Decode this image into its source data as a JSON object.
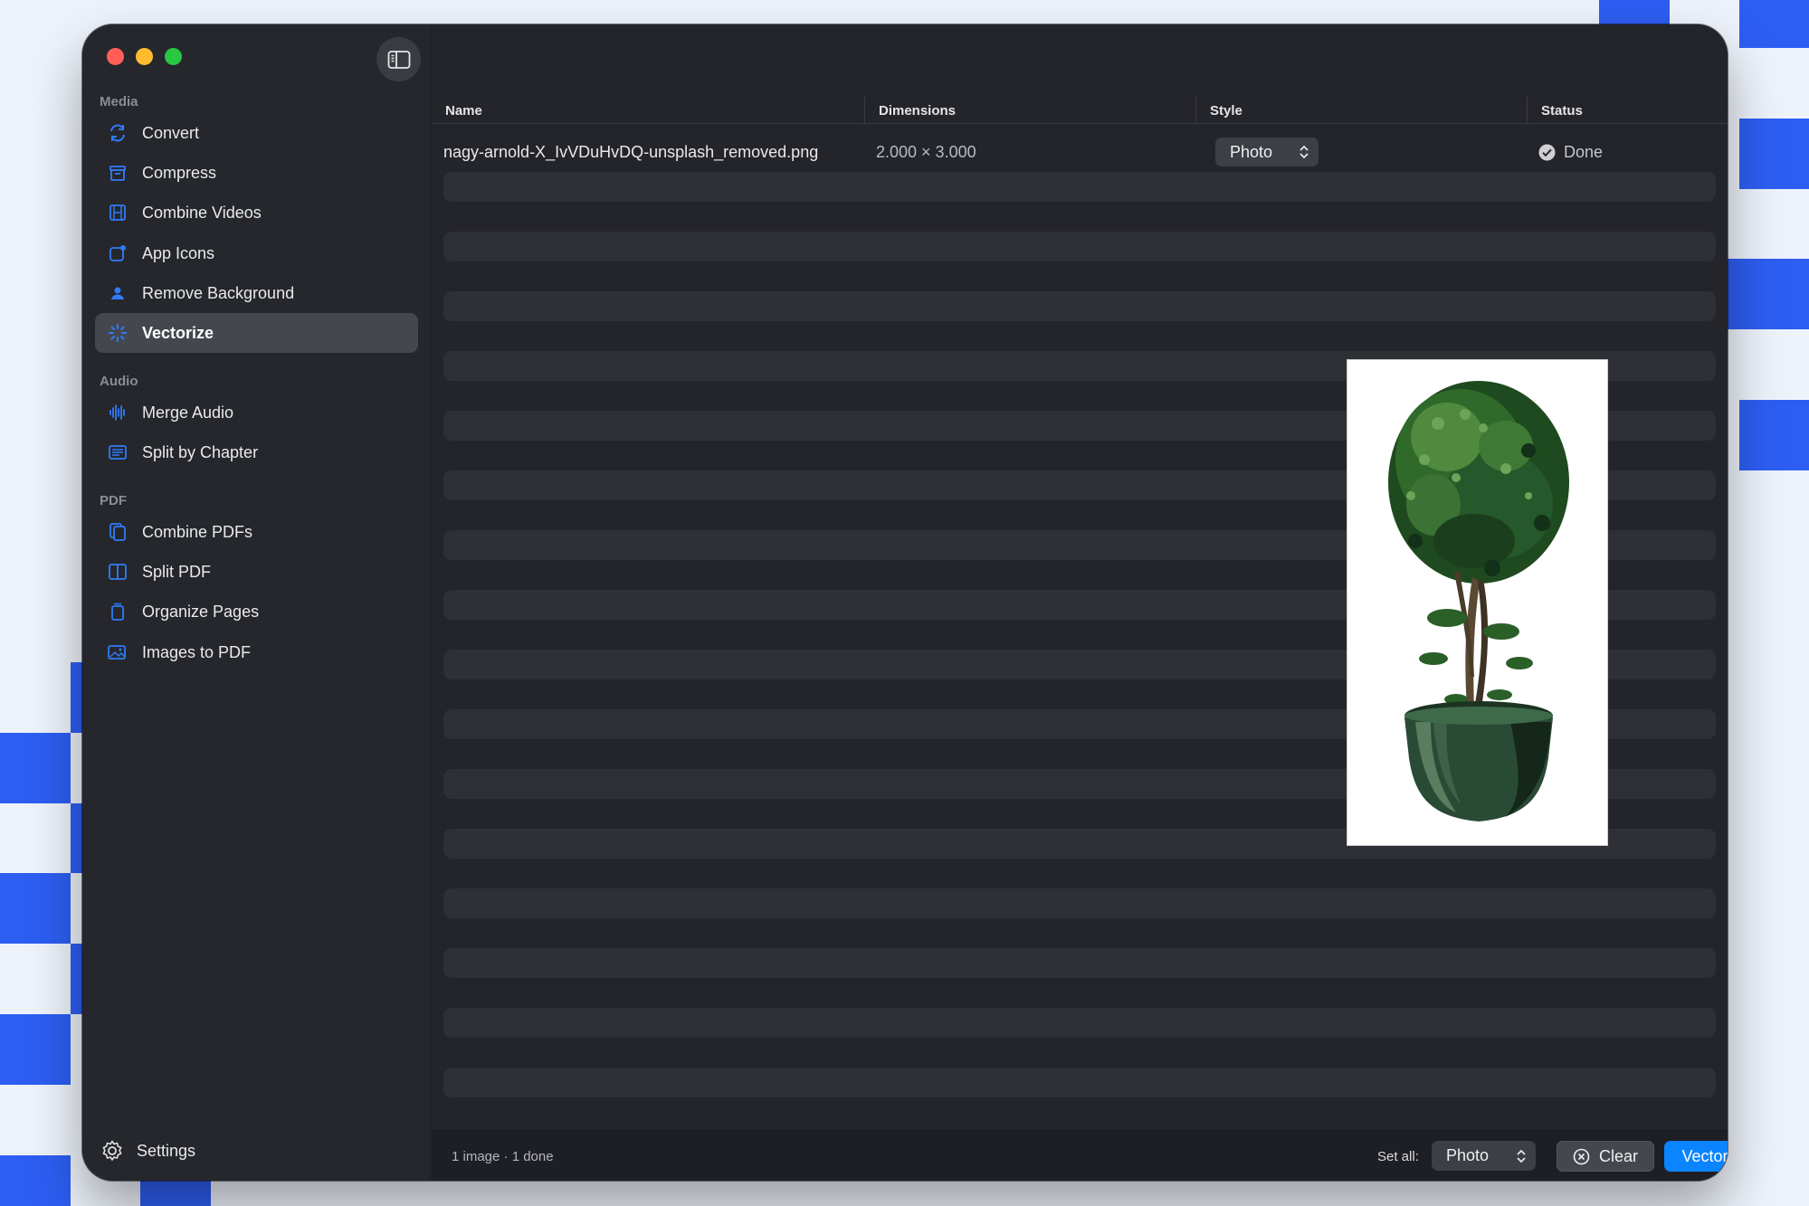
{
  "colors": {
    "accent": "#0a84ff",
    "icon_blue": "#2f7cf6",
    "window_bg": "#24252b",
    "backdrop_square": "#2d5ef2",
    "done_check": "#d0d0d0"
  },
  "window": {
    "traffic_lights": [
      "#ff5f57",
      "#febc2e",
      "#28c840"
    ]
  },
  "sidebar": {
    "toggle_icon": "sidebar-toggle-icon",
    "sections": [
      {
        "title": "Media",
        "items": [
          {
            "label": "Convert",
            "icon": "convert-icon",
            "active": false
          },
          {
            "label": "Compress",
            "icon": "compress-icon",
            "active": false
          },
          {
            "label": "Combine Videos",
            "icon": "film-icon",
            "active": false
          },
          {
            "label": "App Icons",
            "icon": "app-icon",
            "active": false
          },
          {
            "label": "Remove Background",
            "icon": "person-icon",
            "active": false
          },
          {
            "label": "Vectorize",
            "icon": "sparkle-icon",
            "active": true
          }
        ]
      },
      {
        "title": "Audio",
        "items": [
          {
            "label": "Merge Audio",
            "icon": "waveform-icon",
            "active": false
          },
          {
            "label": "Split by Chapter",
            "icon": "chapters-icon",
            "active": false
          }
        ]
      },
      {
        "title": "PDF",
        "items": [
          {
            "label": "Combine PDFs",
            "icon": "docs-icon",
            "active": false
          },
          {
            "label": "Split PDF",
            "icon": "split-icon",
            "active": false
          },
          {
            "label": "Organize Pages",
            "icon": "pages-icon",
            "active": false
          },
          {
            "label": "Images to PDF",
            "icon": "photos-icon",
            "active": false
          }
        ]
      }
    ],
    "settings_label": "Settings"
  },
  "table": {
    "columns": [
      "Name",
      "Dimensions",
      "Style",
      "Status"
    ],
    "rows": [
      {
        "name": "nagy-arnold-X_IvVDuHvDQ-unsplash_removed.png",
        "dimensions": "2.000 × 3.000",
        "style": "Photo",
        "status": "Done"
      }
    ]
  },
  "preview": {
    "subject": "topiary-tree-in-pot"
  },
  "footer": {
    "summary": "1 image · 1 done",
    "set_all_label": "Set all:",
    "set_all_value": "Photo",
    "clear_label": "Clear",
    "vectorize_all_label": "Vectorize All"
  }
}
